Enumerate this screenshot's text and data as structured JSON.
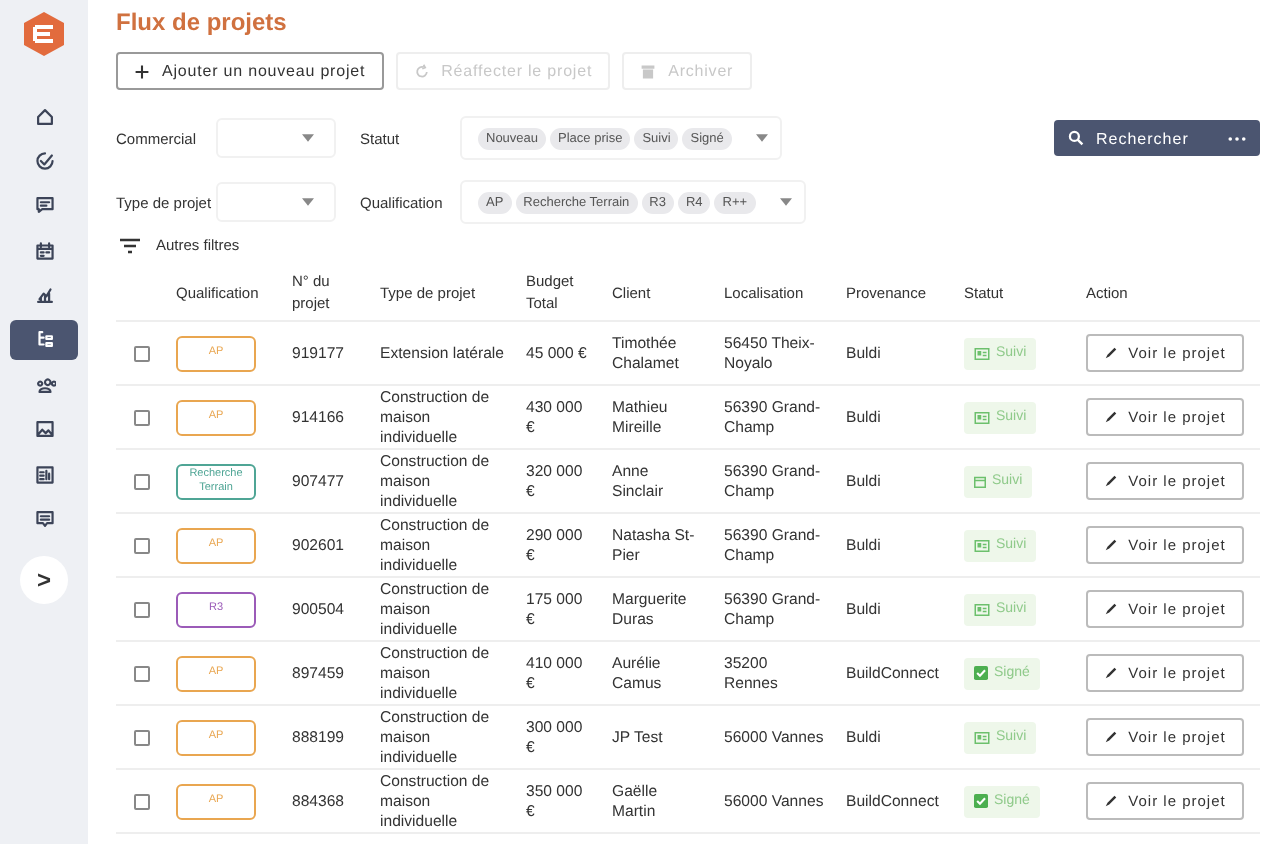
{
  "sidebar": {
    "items": [
      {
        "selected": false
      },
      {
        "selected": false
      },
      {
        "selected": false
      },
      {
        "selected": false
      },
      {
        "selected": false
      },
      {
        "selected": true
      },
      {
        "selected": false
      },
      {
        "selected": false
      },
      {
        "selected": false
      },
      {
        "selected": false
      }
    ],
    "expand": ">"
  },
  "title": "Flux de projets",
  "actions": [
    {
      "label": "Ajouter un nouveau projet",
      "disabled": false
    },
    {
      "label": "Réaffecter le projet",
      "disabled": true
    },
    {
      "label": "Archiver",
      "disabled": true
    }
  ],
  "filters": [
    [
      {
        "label": "Commercial"
      },
      {
        "label": "Statut",
        "chips": [
          "Nouveau",
          "Place prise",
          "Suivi",
          "Signé"
        ]
      }
    ],
    [
      {
        "label": "Type de projet"
      },
      {
        "label": "Qualification",
        "chips": [
          "AP",
          "Recherche Terrain",
          "R3",
          "R4",
          "R++"
        ]
      }
    ]
  ],
  "search_button": "Rechercher",
  "more_filters": "Autres filtres",
  "table": {
    "columns": [
      "Qualification",
      "N° du projet",
      "Type de projet",
      "Budget Total",
      "Client",
      "Localisation",
      "Provenance",
      "Statut",
      "Action"
    ],
    "rows": [
      {
        "checked": false,
        "qualification": {
          "label": "AP",
          "color": "#e9a650"
        },
        "number": "919177",
        "type": "Extension latérale",
        "budget": "45 000 €",
        "client": "Timothée Chalamet",
        "location": "56450 Theix-Noyalo",
        "source": "Buldi",
        "status": {
          "label": "Suivi",
          "kind": "card"
        },
        "action": "Voir le projet"
      },
      {
        "checked": false,
        "qualification": {
          "label": "AP",
          "color": "#e9a650"
        },
        "number": "914166",
        "type": "Construction de maison individuelle",
        "budget": "430 000 €",
        "client": "Mathieu Mireille",
        "location": "56390 Grand-Champ",
        "source": "Buldi",
        "status": {
          "label": "Suivi",
          "kind": "card"
        },
        "action": "Voir le projet"
      },
      {
        "checked": false,
        "qualification": {
          "label": "Recherche Terrain",
          "color": "#4fa595"
        },
        "number": "907477",
        "type": "Construction de maison individuelle",
        "budget": "320 000 €",
        "client": "Anne Sinclair",
        "location": "56390 Grand-Champ",
        "source": "Buldi",
        "status": {
          "label": "Suivi",
          "kind": "calendar"
        },
        "action": "Voir le projet"
      },
      {
        "checked": false,
        "qualification": {
          "label": "AP",
          "color": "#e9a650"
        },
        "number": "902601",
        "type": "Construction de maison individuelle",
        "budget": "290 000 €",
        "client": "Natasha St-Pier",
        "location": "56390 Grand-Champ",
        "source": "Buldi",
        "status": {
          "label": "Suivi",
          "kind": "card"
        },
        "action": "Voir le projet"
      },
      {
        "checked": false,
        "qualification": {
          "label": "R3",
          "color": "#9b5bb8"
        },
        "number": "900504",
        "type": "Construction de maison individuelle",
        "budget": "175 000 €",
        "client": "Marguerite Duras",
        "location": "56390 Grand-Champ",
        "source": "Buldi",
        "status": {
          "label": "Suivi",
          "kind": "card"
        },
        "action": "Voir le projet"
      },
      {
        "checked": false,
        "qualification": {
          "label": "AP",
          "color": "#e9a650"
        },
        "number": "897459",
        "type": "Construction de maison individuelle",
        "budget": "410 000 €",
        "client": "Aurélie Camus",
        "location": "35200 Rennes",
        "source": "BuildConnect",
        "status": {
          "label": "Signé",
          "kind": "check"
        },
        "action": "Voir le projet"
      },
      {
        "checked": false,
        "qualification": {
          "label": "AP",
          "color": "#e9a650"
        },
        "number": "888199",
        "type": "Construction de maison individuelle",
        "budget": "300 000 €",
        "client": "JP Test",
        "location": "56000 Vannes",
        "source": "Buldi",
        "status": {
          "label": "Suivi",
          "kind": "card"
        },
        "action": "Voir le projet"
      },
      {
        "checked": false,
        "qualification": {
          "label": "AP",
          "color": "#e9a650"
        },
        "number": "884368",
        "type": "Construction de maison individuelle",
        "budget": "350 000 €",
        "client": "Gaëlle Martin",
        "location": "56000 Vannes",
        "source": "BuildConnect",
        "status": {
          "label": "Signé",
          "kind": "check"
        },
        "action": "Voir le projet"
      }
    ]
  }
}
